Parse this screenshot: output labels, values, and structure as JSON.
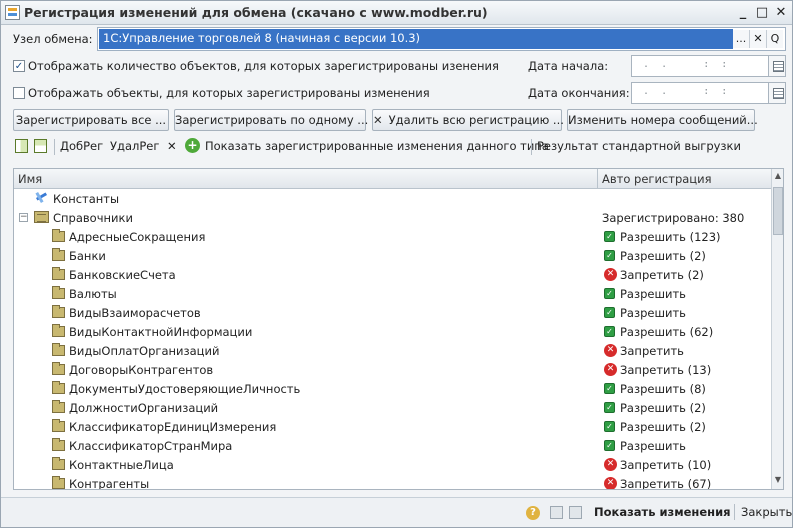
{
  "window": {
    "title": "Регистрация изменений для обмена (скачано с www.modber.ru)",
    "minimize": "_",
    "maximize": "□",
    "close": "✕"
  },
  "node": {
    "label": "Узел обмена:",
    "value": "1С:Управление торговлей 8 (начиная с версии 10.3)",
    "select_btn": "...",
    "clear_btn": "✕",
    "open_btn": "Q"
  },
  "options": {
    "show_count_label": "Отображать количество объектов, для которых зарегистрированы изенения",
    "show_count_checked": true,
    "show_objects_label": "Отображать объекты, для которых зарегистрированы изменения",
    "show_objects_checked": false
  },
  "dates": {
    "start_label": "Дата начала:",
    "start_value": " .  .      :  :",
    "end_label": "Дата окончания:",
    "end_value": " .  .      :  :"
  },
  "buttons": {
    "register_all": "Зарегистрировать все ...",
    "register_one": "Зарегистрировать по одному ...",
    "delete_all": "Удалить всю регистрацию ...",
    "change_numbers": "Изменить номера сообщений..."
  },
  "toolbar": {
    "add_reg": "ДобРег",
    "del_reg": "УдалРег",
    "show_registered": "Показать зарегистрированные изменения данного типа",
    "std_export": "Результат стандартной выгрузки"
  },
  "grid": {
    "col_name": "Имя",
    "col_auto": "Авто регистрация",
    "constants": "Константы",
    "catalogs": "Справочники",
    "catalogs_status": "Зарегистрировано: 380",
    "rows": [
      {
        "name": "АдресныеСокращения",
        "status": "ok",
        "text": "Разрешить (123)"
      },
      {
        "name": "Банки",
        "status": "ok",
        "text": "Разрешить (2)"
      },
      {
        "name": "БанковскиеСчета",
        "status": "no",
        "text": "Запретить (2)"
      },
      {
        "name": "Валюты",
        "status": "ok",
        "text": "Разрешить"
      },
      {
        "name": "ВидыВзаиморасчетов",
        "status": "ok",
        "text": "Разрешить"
      },
      {
        "name": "ВидыКонтактнойИнформации",
        "status": "ok",
        "text": "Разрешить (62)"
      },
      {
        "name": "ВидыОплатОрганизаций",
        "status": "no",
        "text": "Запретить"
      },
      {
        "name": "ДоговорыКонтрагентов",
        "status": "no",
        "text": "Запретить (13)"
      },
      {
        "name": "ДокументыУдостоверяющиеЛичность",
        "status": "ok",
        "text": "Разрешить (8)"
      },
      {
        "name": "ДолжностиОрганизаций",
        "status": "ok",
        "text": "Разрешить (2)"
      },
      {
        "name": "КлассификаторЕдиницИзмерения",
        "status": "ok",
        "text": "Разрешить (2)"
      },
      {
        "name": "КлассификаторСтранМира",
        "status": "ok",
        "text": "Разрешить"
      },
      {
        "name": "КонтактныеЛица",
        "status": "no",
        "text": "Запретить (10)"
      },
      {
        "name": "Контрагенты",
        "status": "no",
        "text": "Запретить (67)"
      }
    ]
  },
  "status_bar": {
    "show_changes": "Показать изменения",
    "close": "Закрыть"
  },
  "colors": {
    "selection": "#3873c6",
    "allow": "#2f9e44",
    "deny": "#d62b2b"
  }
}
